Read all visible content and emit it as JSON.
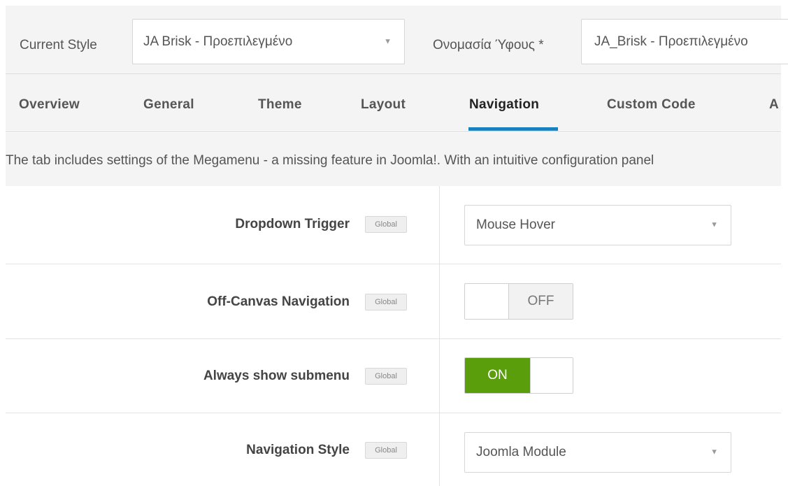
{
  "top": {
    "current_style_label": "Current Style",
    "current_style_value": "JA Brisk - Προεπιλεγμένο",
    "style_name_label": "Ονομασία Ύφους *",
    "style_name_value": "JA_Brisk - Προεπιλεγμένο"
  },
  "tabs": [
    {
      "label": "Overview",
      "active": false
    },
    {
      "label": "General",
      "active": false
    },
    {
      "label": "Theme",
      "active": false
    },
    {
      "label": "Layout",
      "active": false
    },
    {
      "label": "Navigation",
      "active": true
    },
    {
      "label": "Custom Code",
      "active": false
    },
    {
      "label": "A",
      "active": false
    }
  ],
  "description": "The tab includes settings of the Megamenu - a missing feature in Joomla!. With an intuitive configuration panel",
  "fields": {
    "dropdown_trigger": {
      "label": "Dropdown Trigger",
      "badge": "Global",
      "value": "Mouse Hover"
    },
    "off_canvas": {
      "label": "Off-Canvas Navigation",
      "badge": "Global",
      "value": "OFF"
    },
    "always_show_submenu": {
      "label": "Always show submenu",
      "badge": "Global",
      "value": "ON"
    },
    "navigation_style": {
      "label": "Navigation Style",
      "badge": "Global",
      "value": "Joomla Module"
    }
  },
  "colors": {
    "accent": "#1b7fc0",
    "on_toggle": "#5a9e0c"
  }
}
